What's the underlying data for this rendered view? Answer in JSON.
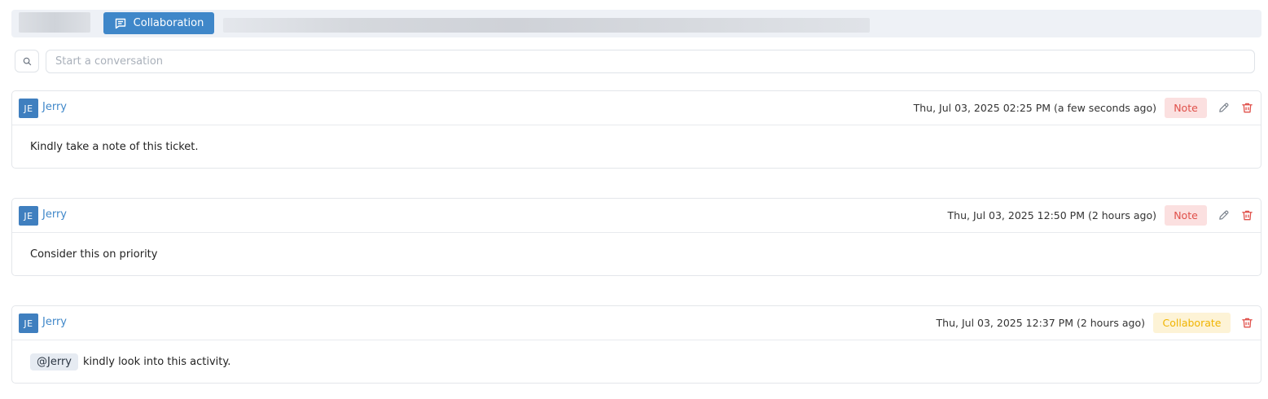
{
  "tabs": {
    "collaboration_label": "Collaboration"
  },
  "search": {
    "placeholder": "Start a conversation"
  },
  "colors": {
    "accent": "#3f87c9",
    "note_bg": "#fbe0e0",
    "note_text": "#e0504a",
    "collab_bg": "#fdf3d6",
    "collab_text": "#f0b400",
    "delete": "#e0504a"
  },
  "conversations": [
    {
      "avatar": "JE",
      "author": "Jerry",
      "timestamp": "Thu, Jul 03, 2025 02:25 PM (a few seconds ago)",
      "badge": "Note",
      "body": "Kindly take a note of this ticket."
    },
    {
      "avatar": "JE",
      "author": "Jerry",
      "timestamp": "Thu, Jul 03, 2025 12:50 PM (2 hours ago)",
      "badge": "Note",
      "body": "Consider this on priority"
    },
    {
      "avatar": "JE",
      "author": "Jerry",
      "timestamp": "Thu, Jul 03, 2025 12:37 PM (2 hours ago)",
      "badge": "Collaborate",
      "mention": "@Jerry",
      "body": "kindly look into this activity."
    }
  ]
}
